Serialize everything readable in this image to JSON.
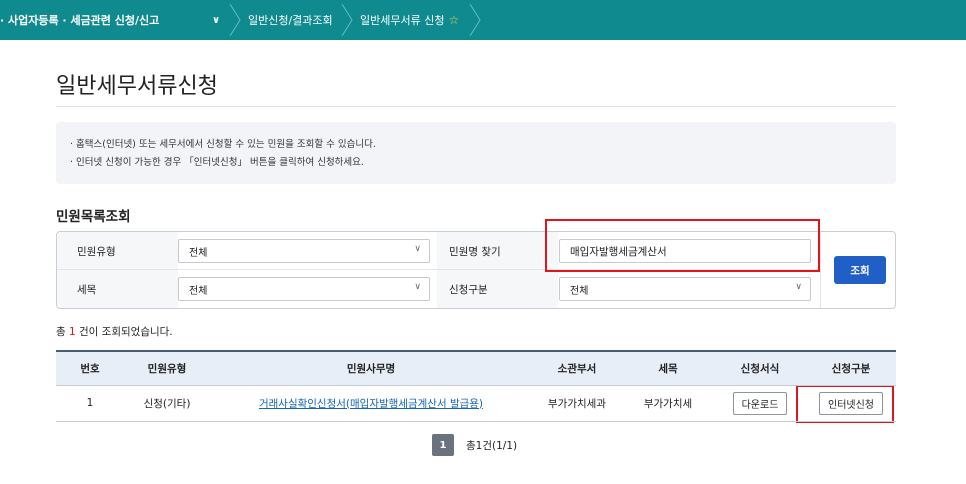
{
  "topbar": {
    "crumb1": "· 사업자등록 · 세금관련 신청/신고",
    "dropdown_glyph": "∨",
    "crumb2": "일반신청/결과조회",
    "crumb3": "일반세무서류 신청",
    "star": "☆"
  },
  "page_title": "일반세무서류신청",
  "notice": {
    "line1": "· 홈택스(인터넷) 또는 세무서에서 신청할 수 있는 민원을 조회할 수 있습니다.",
    "line2": "· 인터넷 신청이 가능한 경우 「인터넷신청」 버튼을 클릭하여 신청하세요."
  },
  "search": {
    "section_title": "민원목록조회",
    "type_label": "민원유형",
    "type_value": "전체",
    "name_label": "민원명 찾기",
    "name_value": "매입자발행세금계산서",
    "tax_label": "세목",
    "tax_value": "전체",
    "apply_label": "신청구분",
    "apply_value": "전체",
    "chevron": "∨",
    "button": "조회"
  },
  "result": {
    "prefix": "총 ",
    "count": "1",
    "suffix": " 건이 조회되었습니다."
  },
  "table": {
    "headers": [
      "번호",
      "민원유형",
      "민원사무명",
      "소관부서",
      "세목",
      "신청서식",
      "신청구분"
    ],
    "rows": [
      {
        "no": "1",
        "type": "신청(기타)",
        "name": "거래사실확인신청서(매입자발행세금계산서 발급용)",
        "dept": "부가가치세과",
        "tax": "부가가치세",
        "form_btn": "다운로드",
        "apply_btn": "인터넷신청"
      }
    ]
  },
  "pager": {
    "current": "1",
    "summary": "총1건(1/1)"
  },
  "colors": {
    "topbar": "#0f8a8f",
    "primary_button": "#1f5fc6",
    "highlight_box": "#e0161f",
    "link": "#1465b8"
  }
}
